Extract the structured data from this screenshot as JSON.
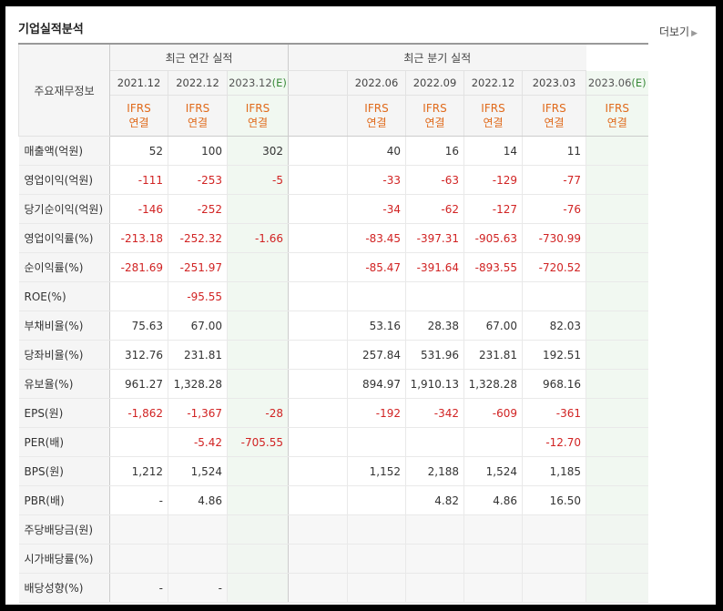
{
  "title": "기업실적분석",
  "more_label": "더보기",
  "header": {
    "row_label": "주요재무정보",
    "annual_group": "최근 연간 실적",
    "quarterly_group": "최근 분기 실적",
    "annual_periods": [
      {
        "label": "2021.12",
        "estimate": false
      },
      {
        "label": "2022.12",
        "estimate": false
      },
      {
        "label": "2023.12",
        "estimate": true
      }
    ],
    "quarterly_periods": [
      {
        "label": "2022.06",
        "estimate": false
      },
      {
        "label": "2022.09",
        "estimate": false
      },
      {
        "label": "2022.12",
        "estimate": false
      },
      {
        "label": "2023.03",
        "estimate": false
      },
      {
        "label": "2023.06",
        "estimate": true
      }
    ],
    "estimate_mark": "(E)",
    "ifrs_line1": "IFRS",
    "ifrs_line2": "연결"
  },
  "rows": [
    {
      "label": "매출액(억원)",
      "annual": [
        "52",
        "100",
        "302"
      ],
      "quarterly": [
        "40",
        "16",
        "14",
        "11",
        ""
      ],
      "sep": false
    },
    {
      "label": "영업이익(억원)",
      "annual": [
        "-111",
        "-253",
        "-5"
      ],
      "quarterly": [
        "-33",
        "-63",
        "-129",
        "-77",
        ""
      ],
      "sep": false
    },
    {
      "label": "당기순이익(억원)",
      "annual": [
        "-146",
        "-252",
        ""
      ],
      "quarterly": [
        "-34",
        "-62",
        "-127",
        "-76",
        ""
      ],
      "sep": false
    },
    {
      "label": "영업이익률(%)",
      "annual": [
        "-213.18",
        "-252.32",
        "-1.66"
      ],
      "quarterly": [
        "-83.45",
        "-397.31",
        "-905.63",
        "-730.99",
        ""
      ],
      "sep": true
    },
    {
      "label": "순이익률(%)",
      "annual": [
        "-281.69",
        "-251.97",
        ""
      ],
      "quarterly": [
        "-85.47",
        "-391.64",
        "-893.55",
        "-720.52",
        ""
      ],
      "sep": false
    },
    {
      "label": "ROE(%)",
      "annual": [
        "",
        "-95.55",
        ""
      ],
      "quarterly": [
        "",
        "",
        "",
        "",
        ""
      ],
      "sep": false
    },
    {
      "label": "부채비율(%)",
      "annual": [
        "75.63",
        "67.00",
        ""
      ],
      "quarterly": [
        "53.16",
        "28.38",
        "67.00",
        "82.03",
        ""
      ],
      "sep": true
    },
    {
      "label": "당좌비율(%)",
      "annual": [
        "312.76",
        "231.81",
        ""
      ],
      "quarterly": [
        "257.84",
        "531.96",
        "231.81",
        "192.51",
        ""
      ],
      "sep": false
    },
    {
      "label": "유보율(%)",
      "annual": [
        "961.27",
        "1,328.28",
        ""
      ],
      "quarterly": [
        "894.97",
        "1,910.13",
        "1,328.28",
        "968.16",
        ""
      ],
      "sep": false
    },
    {
      "label": "EPS(원)",
      "annual": [
        "-1,862",
        "-1,367",
        "-28"
      ],
      "quarterly": [
        "-192",
        "-342",
        "-609",
        "-361",
        ""
      ],
      "sep": true
    },
    {
      "label": "PER(배)",
      "annual": [
        "",
        "-5.42",
        "-705.55"
      ],
      "quarterly": [
        "",
        "",
        "",
        "-12.70",
        ""
      ],
      "sep": false
    },
    {
      "label": "BPS(원)",
      "annual": [
        "1,212",
        "1,524",
        ""
      ],
      "quarterly": [
        "1,152",
        "2,188",
        "1,524",
        "1,185",
        ""
      ],
      "sep": false
    },
    {
      "label": "PBR(배)",
      "annual": [
        "-",
        "4.86",
        ""
      ],
      "quarterly": [
        "",
        "4.82",
        "4.86",
        "16.50",
        ""
      ],
      "sep": false
    },
    {
      "label": "주당배당금(원)",
      "annual": [
        "",
        "",
        ""
      ],
      "quarterly": [
        "",
        "",
        "",
        "",
        ""
      ],
      "sep": true,
      "blank": true
    },
    {
      "label": "시가배당률(%)",
      "annual": [
        "",
        "",
        ""
      ],
      "quarterly": [
        "",
        "",
        "",
        "",
        ""
      ],
      "sep": false,
      "blank": true
    },
    {
      "label": "배당성향(%)",
      "annual": [
        "-",
        "-",
        ""
      ],
      "quarterly": [
        "",
        "",
        "",
        "",
        ""
      ],
      "sep": false,
      "blank": true
    }
  ],
  "colors": {
    "negative": "#d12323",
    "ifrs": "#e06a1b",
    "estimate_bg": "#f1f8f1",
    "estimate_mark": "#3a8a3a"
  }
}
